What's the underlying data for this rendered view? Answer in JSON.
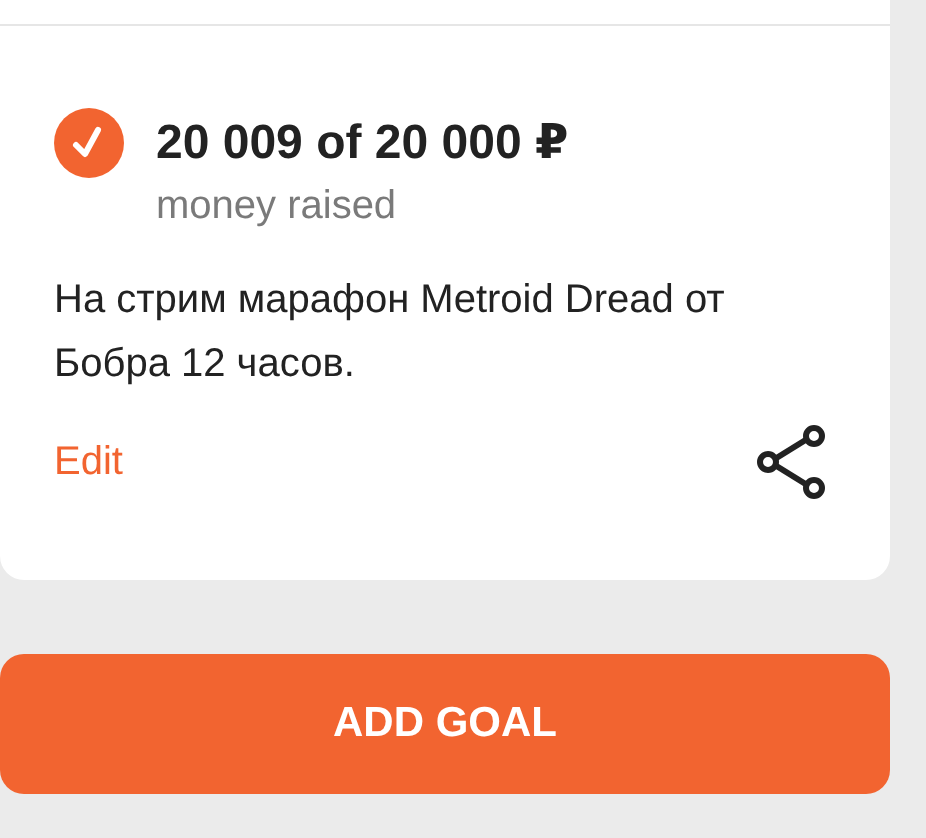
{
  "goal": {
    "completed": true,
    "amount": "20 009 of 20 000 ₽",
    "caption": "money raised",
    "description": "На стрим марафон Metroid Dread от Бобра 12 часов.",
    "edit_link": "Edit"
  },
  "add_button": "ADD GOAL"
}
